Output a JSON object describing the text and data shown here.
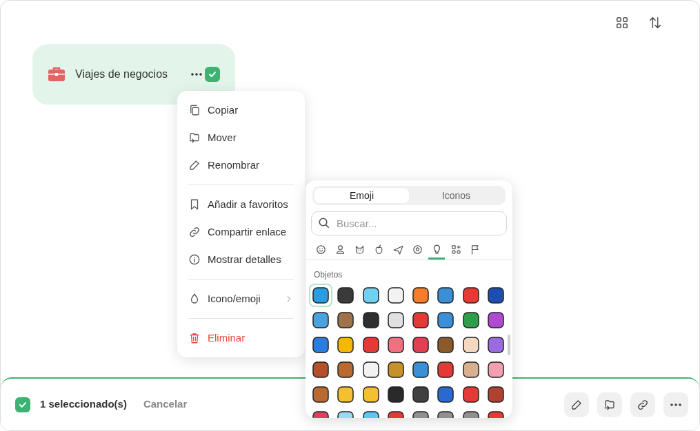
{
  "folder": {
    "name": "Viajes de negocios",
    "color": "#e06666",
    "checked": true
  },
  "context_menu": {
    "groups": [
      [
        {
          "label": "Copiar",
          "kind": "copy"
        },
        {
          "label": "Mover",
          "kind": "move"
        },
        {
          "label": "Renombrar",
          "kind": "rename"
        }
      ],
      [
        {
          "label": "Añadir a favoritos",
          "kind": "bookmark"
        },
        {
          "label": "Compartir enlace",
          "kind": "link"
        },
        {
          "label": "Mostrar detalles",
          "kind": "info"
        }
      ],
      [
        {
          "label": "Icono/emoji",
          "kind": "drop",
          "submenu": true
        }
      ],
      [
        {
          "label": "Eliminar",
          "kind": "delete",
          "danger": true
        }
      ]
    ]
  },
  "picker": {
    "tabs": [
      {
        "label": "Emoji",
        "selected": true
      },
      {
        "label": "Iconos",
        "selected": false
      }
    ],
    "search": {
      "placeholder": "Buscar..."
    },
    "categories": [
      {
        "kind": "smile",
        "selected": false
      },
      {
        "kind": "person",
        "selected": false
      },
      {
        "kind": "cat",
        "selected": false
      },
      {
        "kind": "apple",
        "selected": false
      },
      {
        "kind": "plane",
        "selected": false
      },
      {
        "kind": "ball",
        "selected": false
      },
      {
        "kind": "bulb",
        "selected": true
      },
      {
        "kind": "symbols",
        "selected": false
      },
      {
        "kind": "flag",
        "selected": false
      }
    ],
    "section_title": "Objetos",
    "emojis": [
      {
        "color": "#2a9de0",
        "selected": true
      },
      {
        "color": "#3a3a3a",
        "selected": false
      },
      {
        "color": "#6fd0f0",
        "selected": false
      },
      {
        "color": "#f2f2f2",
        "selected": false
      },
      {
        "color": "#f57c2a",
        "selected": false
      },
      {
        "color": "#3b8fd6",
        "selected": false
      },
      {
        "color": "#e53935",
        "selected": false
      },
      {
        "color": "#1e4fb0",
        "selected": false
      },
      {
        "color": "#4aa3e0",
        "selected": false
      },
      {
        "color": "#a0724a",
        "selected": false
      },
      {
        "color": "#2f2f2f",
        "selected": false
      },
      {
        "color": "#e0e0e0",
        "selected": false
      },
      {
        "color": "#e53935",
        "selected": false
      },
      {
        "color": "#3b8fd6",
        "selected": false
      },
      {
        "color": "#2e9e4a",
        "selected": false
      },
      {
        "color": "#b04ad0",
        "selected": false
      },
      {
        "color": "#2a7de0",
        "selected": false
      },
      {
        "color": "#f5b800",
        "selected": false
      },
      {
        "color": "#e53935",
        "selected": false
      },
      {
        "color": "#f07080",
        "selected": false
      },
      {
        "color": "#e04050",
        "selected": false
      },
      {
        "color": "#8a5a2a",
        "selected": false
      },
      {
        "color": "#f5d8c0",
        "selected": false
      },
      {
        "color": "#9a6ae0",
        "selected": false
      },
      {
        "color": "#b5502a",
        "selected": false
      },
      {
        "color": "#b86a30",
        "selected": false
      },
      {
        "color": "#f2f2f2",
        "selected": false
      },
      {
        "color": "#c8902a",
        "selected": false
      },
      {
        "color": "#3b8fd6",
        "selected": false
      },
      {
        "color": "#e53935",
        "selected": false
      },
      {
        "color": "#d8b090",
        "selected": false
      },
      {
        "color": "#f2a0b0",
        "selected": false
      },
      {
        "color": "#b86a30",
        "selected": false
      },
      {
        "color": "#f5c030",
        "selected": false
      },
      {
        "color": "#f5c030",
        "selected": false
      },
      {
        "color": "#2a2a2a",
        "selected": false
      },
      {
        "color": "#404040",
        "selected": false
      },
      {
        "color": "#2a6ad0",
        "selected": false
      },
      {
        "color": "#e53935",
        "selected": false
      },
      {
        "color": "#b04030",
        "selected": false
      },
      {
        "color": "#e04060",
        "selected": false
      },
      {
        "color": "#9adaf0",
        "selected": false
      },
      {
        "color": "#5ac8f0",
        "selected": false
      },
      {
        "color": "#e53935",
        "selected": false
      },
      {
        "color": "#909090",
        "selected": false
      },
      {
        "color": "#909090",
        "selected": false
      },
      {
        "color": "#909090",
        "selected": false
      },
      {
        "color": "#e53935",
        "selected": false
      }
    ]
  },
  "selection_bar": {
    "checked": true,
    "count": "1 seleccionado(s)",
    "cancel": "Cancelar",
    "actions": [
      {
        "kind": "rename"
      },
      {
        "kind": "move"
      },
      {
        "kind": "link"
      },
      {
        "kind": "more"
      }
    ]
  }
}
